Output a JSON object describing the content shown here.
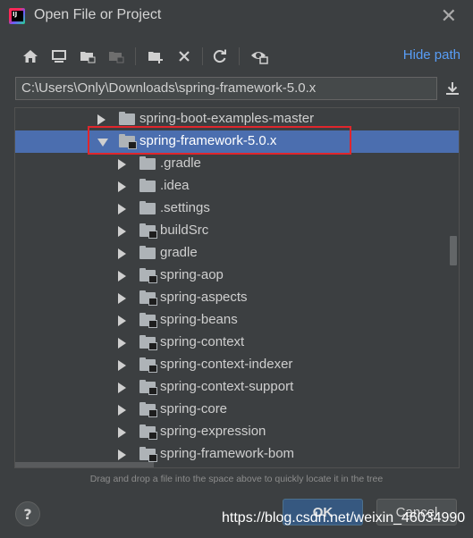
{
  "window": {
    "title": "Open File or Project",
    "app_icon_text": "IJ"
  },
  "toolbar": {
    "buttons": [
      "home-icon",
      "desktop-icon",
      "project-folder-icon",
      "module-folder-icon",
      "new-folder-icon",
      "delete-icon",
      "refresh-icon",
      "show-hidden-icon"
    ],
    "hide_path_label": "Hide path"
  },
  "path": {
    "value": "C:\\Users\\Only\\Downloads\\spring-framework-5.0.x"
  },
  "tree": {
    "items": [
      {
        "label": "spring-boot-examples-master",
        "depth": 0,
        "expanded": false,
        "selected": false,
        "module": false
      },
      {
        "label": "spring-framework-5.0.x",
        "depth": 0,
        "expanded": true,
        "selected": true,
        "module": true
      },
      {
        "label": ".gradle",
        "depth": 1,
        "expanded": false,
        "selected": false,
        "module": false
      },
      {
        "label": ".idea",
        "depth": 1,
        "expanded": false,
        "selected": false,
        "module": false
      },
      {
        "label": ".settings",
        "depth": 1,
        "expanded": false,
        "selected": false,
        "module": false
      },
      {
        "label": "buildSrc",
        "depth": 1,
        "expanded": false,
        "selected": false,
        "module": true
      },
      {
        "label": "gradle",
        "depth": 1,
        "expanded": false,
        "selected": false,
        "module": false
      },
      {
        "label": "spring-aop",
        "depth": 1,
        "expanded": false,
        "selected": false,
        "module": true
      },
      {
        "label": "spring-aspects",
        "depth": 1,
        "expanded": false,
        "selected": false,
        "module": true
      },
      {
        "label": "spring-beans",
        "depth": 1,
        "expanded": false,
        "selected": false,
        "module": true
      },
      {
        "label": "spring-context",
        "depth": 1,
        "expanded": false,
        "selected": false,
        "module": true
      },
      {
        "label": "spring-context-indexer",
        "depth": 1,
        "expanded": false,
        "selected": false,
        "module": true
      },
      {
        "label": "spring-context-support",
        "depth": 1,
        "expanded": false,
        "selected": false,
        "module": true
      },
      {
        "label": "spring-core",
        "depth": 1,
        "expanded": false,
        "selected": false,
        "module": true
      },
      {
        "label": "spring-expression",
        "depth": 1,
        "expanded": false,
        "selected": false,
        "module": true
      },
      {
        "label": "spring-framework-bom",
        "depth": 1,
        "expanded": false,
        "selected": false,
        "module": true
      }
    ]
  },
  "hint": "Drag and drop a file into the space above to quickly locate it in the tree",
  "footer": {
    "help_label": "?",
    "ok_label": "OK",
    "cancel_label": "Cancel"
  },
  "watermark": "https://blog.csdn.net/weixin_46034990",
  "colors": {
    "background": "#3c3f41",
    "selection": "#4b6eaf",
    "link": "#589df6",
    "highlight_box": "#e0262c",
    "ok_button": "#365880"
  }
}
